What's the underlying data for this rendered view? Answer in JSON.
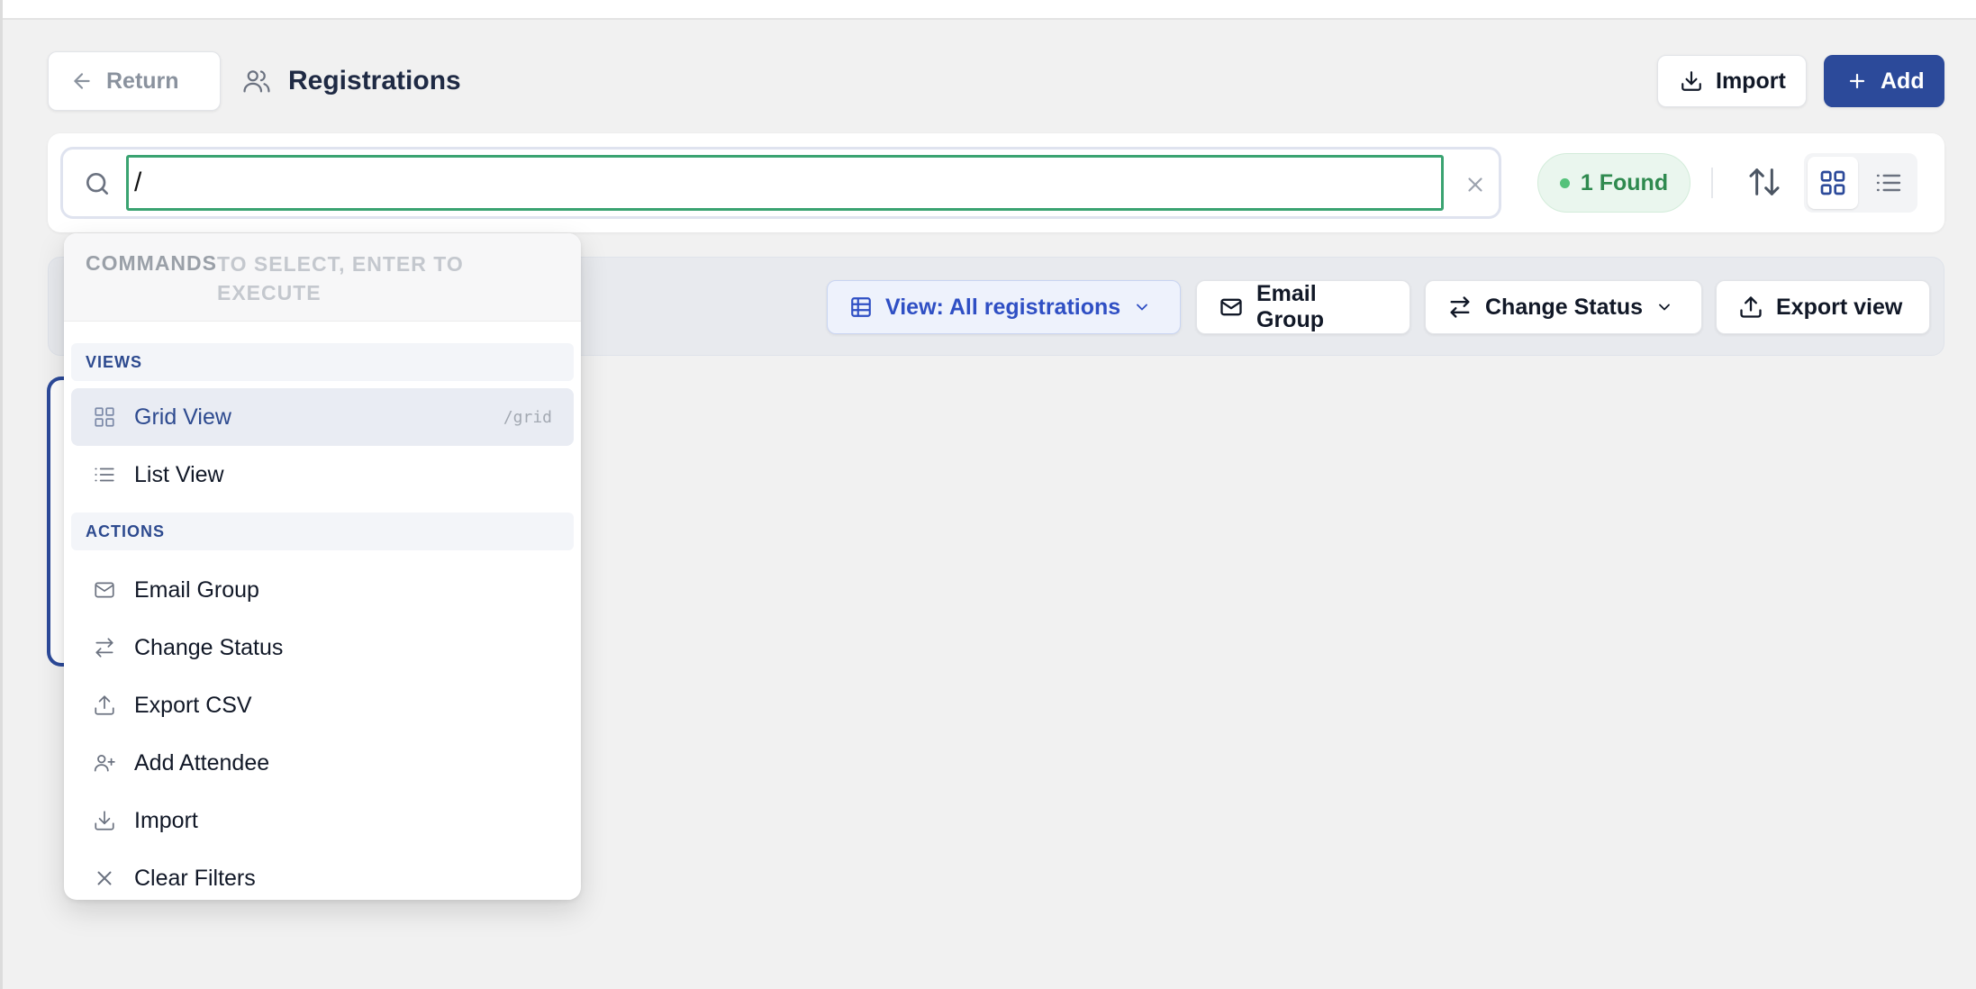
{
  "header": {
    "return_label": "Return",
    "page_title": "Registrations",
    "import_label": "Import",
    "add_label": "Add"
  },
  "search": {
    "value": "/",
    "found_label": "1 Found"
  },
  "toolbar": {
    "view_label": "View: All registrations",
    "email_group_label": "Email Group",
    "change_status_label": "Change Status",
    "export_view_label": "Export view"
  },
  "command_palette": {
    "header_title": "COMMANDS",
    "header_hint": "TO SELECT, ENTER TO EXECUTE",
    "sections": [
      {
        "label": "VIEWS",
        "items": [
          {
            "label": "Grid View",
            "icon": "grid-icon",
            "shortcut": "/grid",
            "active": true
          },
          {
            "label": "List View",
            "icon": "list-icon"
          }
        ]
      },
      {
        "label": "ACTIONS",
        "items": [
          {
            "label": "Email Group",
            "icon": "mail-icon"
          },
          {
            "label": "Change Status",
            "icon": "swap-icon"
          },
          {
            "label": "Export CSV",
            "icon": "upload-icon"
          },
          {
            "label": "Add Attendee",
            "icon": "user-plus-icon"
          },
          {
            "label": "Import",
            "icon": "download-icon"
          },
          {
            "label": "Clear Filters",
            "icon": "close-icon"
          }
        ]
      }
    ]
  },
  "colors": {
    "primary": "#2c4a9a",
    "success": "#2f8a4f",
    "focus_border": "#3aa371",
    "view_accent": "#2f4fc4"
  }
}
